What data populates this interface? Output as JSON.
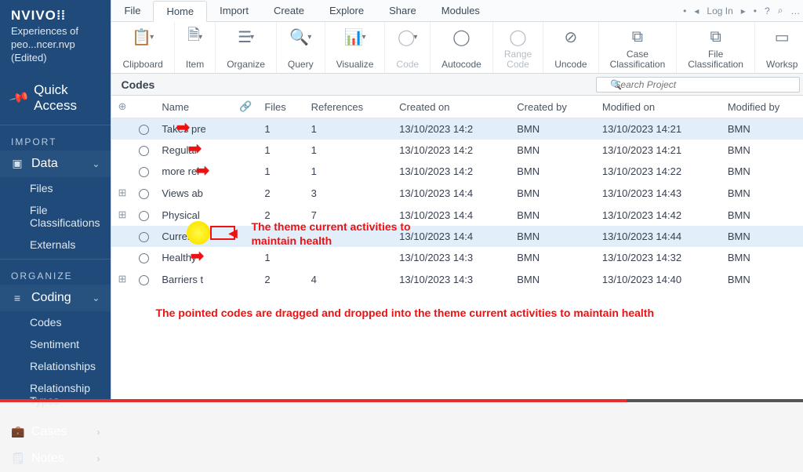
{
  "app": {
    "logo": "NVIVO",
    "project_line1": "Experiences of peo...ncer.nvp",
    "project_line2": "(Edited)",
    "quick_access": "Quick Access"
  },
  "sidebar": {
    "section_import": "IMPORT",
    "data": {
      "title": "Data",
      "expanded": true
    },
    "data_children": [
      "Files",
      "File Classifications",
      "Externals"
    ],
    "section_organize": "ORGANIZE",
    "coding": {
      "title": "Coding",
      "expanded": true
    },
    "coding_children": [
      "Codes",
      "Sentiment",
      "Relationships",
      "Relationship Types"
    ],
    "cases": "Cases",
    "notes": "Notes"
  },
  "menu": {
    "tabs": [
      "File",
      "Home",
      "Import",
      "Create",
      "Explore",
      "Share",
      "Modules"
    ],
    "active_index": 1,
    "login": "Log In"
  },
  "ribbon": [
    {
      "icon": "📋",
      "label": "Clipboard",
      "drop": true
    },
    {
      "icon": "🗎",
      "label": "Item",
      "drop": true
    },
    {
      "icon": "☰",
      "label": "Organize",
      "drop": true
    },
    {
      "icon": "🔍",
      "label": "Query",
      "drop": true
    },
    {
      "icon": "📊",
      "label": "Visualize",
      "drop": true
    },
    {
      "icon": "◯",
      "label": "Code",
      "disabled": true,
      "drop": true
    },
    {
      "icon": "◯",
      "label": "Autocode"
    },
    {
      "icon": "◯",
      "label": "Range\nCode",
      "disabled": true
    },
    {
      "icon": "⊘",
      "label": "Uncode"
    },
    {
      "icon": "⧉",
      "label": "Case\nClassification"
    },
    {
      "icon": "⧉",
      "label": "File\nClassification"
    },
    {
      "icon": "▭",
      "label": "Worksp"
    }
  ],
  "panel": {
    "title": "Codes"
  },
  "search": {
    "placeholder": "Search Project"
  },
  "columns": [
    "",
    "",
    "Name",
    "",
    "Files",
    "References",
    "Created on",
    "Created by",
    "Modified on",
    "Modified by"
  ],
  "rows": [
    {
      "name": "Takes pre",
      "files": "1",
      "refs": "1",
      "created": "13/10/2023 14:2",
      "cby": "BMN",
      "modified": "13/10/2023 14:21",
      "mby": "BMN",
      "sel": true
    },
    {
      "name": "Regular",
      "files": "1",
      "refs": "1",
      "created": "13/10/2023 14:2",
      "cby": "BMN",
      "modified": "13/10/2023 14:21",
      "mby": "BMN"
    },
    {
      "name": "more rel",
      "files": "1",
      "refs": "1",
      "created": "13/10/2023 14:2",
      "cby": "BMN",
      "modified": "13/10/2023 14:22",
      "mby": "BMN"
    },
    {
      "name": "Views ab",
      "files": "2",
      "refs": "3",
      "created": "13/10/2023 14:4",
      "cby": "BMN",
      "modified": "13/10/2023 14:43",
      "mby": "BMN",
      "exp": "⊞"
    },
    {
      "name": "Physical",
      "files": "2",
      "refs": "7",
      "created": "13/10/2023 14:4",
      "cby": "BMN",
      "modified": "13/10/2023 14:42",
      "mby": "BMN",
      "exp": "⊞"
    },
    {
      "name": "Current",
      "files": "",
      "refs": "",
      "created": "13/10/2023 14:4",
      "cby": "BMN",
      "modified": "13/10/2023 14:44",
      "mby": "BMN",
      "sel": true
    },
    {
      "name": "Healthy",
      "files": "1",
      "refs": "",
      "created": "13/10/2023 14:3",
      "cby": "BMN",
      "modified": "13/10/2023 14:32",
      "mby": "BMN"
    },
    {
      "name": "Barriers t",
      "files": "2",
      "refs": "4",
      "created": "13/10/2023 14:3",
      "cby": "BMN",
      "modified": "13/10/2023 14:40",
      "mby": "BMN",
      "exp": "⊞"
    }
  ],
  "annotations": {
    "line1": "The theme current activities to",
    "line2": "maintain health",
    "para": "The pointed codes are dragged and dropped into the theme current activities to maintain\nhealth"
  },
  "progress_pct": 78
}
